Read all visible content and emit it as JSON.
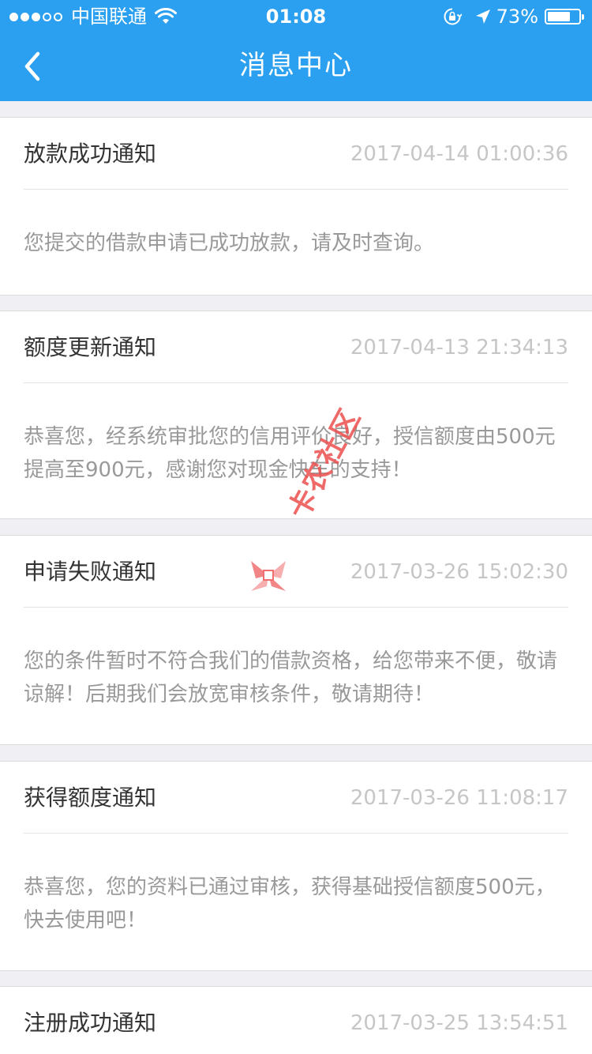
{
  "status_bar": {
    "carrier": "中国联通",
    "time": "01:08",
    "battery_percent": "73%",
    "battery_level": 0.73,
    "signal_bars_filled": 3,
    "signal_bars_total": 5
  },
  "nav": {
    "title": "消息中心",
    "back_icon": "chevron-left-icon"
  },
  "colors": {
    "header_bg": "#2b9ff0",
    "page_bg": "#efeff4",
    "title_text": "#333333",
    "time_text": "#c6c6c6",
    "body_text": "#999999"
  },
  "messages": [
    {
      "title": "放款成功通知",
      "time": "2017-04-14 01:00:36",
      "body": "您提交的借款申请已成功放款，请及时查询。"
    },
    {
      "title": "额度更新通知",
      "time": "2017-04-13 21:34:13",
      "body": "恭喜您，经系统审批您的信用评价良好，授信额度由500元提高至900元，感谢您对现金快车的支持！"
    },
    {
      "title": "申请失败通知",
      "time": "2017-03-26 15:02:30",
      "body": "您的条件暂时不符合我们的借款资格，给您带来不便，敬请谅解！后期我们会放宽审核条件，敬请期待！"
    },
    {
      "title": "获得额度通知",
      "time": "2017-03-26 11:08:17",
      "body": "恭喜您，您的资料已通过审核，获得基础授信额度500元，快去使用吧！"
    },
    {
      "title": "注册成功通知",
      "time": "2017-03-25 13:54:51",
      "body": ""
    }
  ],
  "watermark": {
    "text": "卡农社区"
  }
}
